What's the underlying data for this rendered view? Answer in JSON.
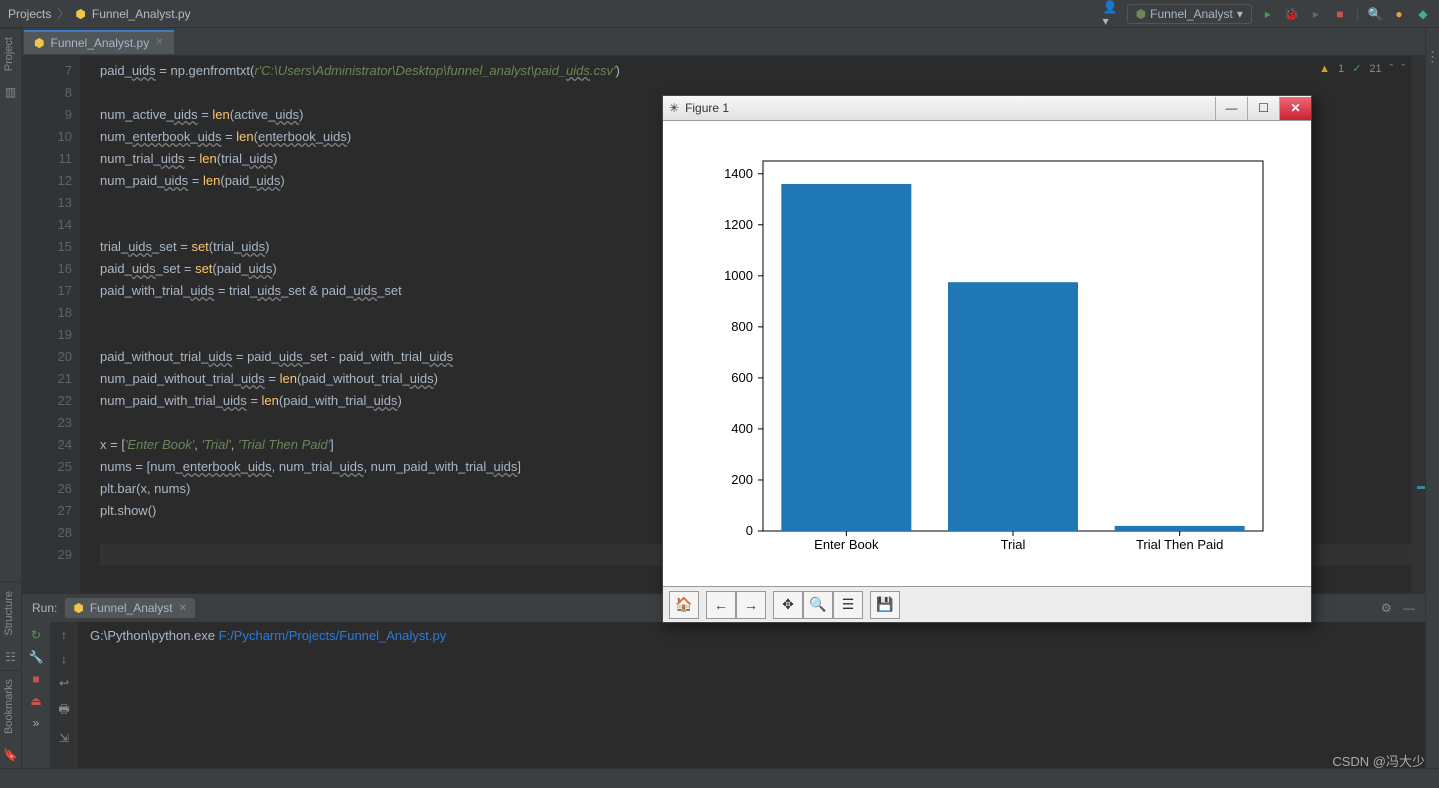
{
  "breadcrumb": {
    "root": "Projects",
    "file": "Funnel_Analyst.py"
  },
  "run_config": {
    "label": "Funnel_Analyst"
  },
  "editor_tab": {
    "label": "Funnel_Analyst.py"
  },
  "editor_status": {
    "warnings": "1",
    "weak_warnings": "21"
  },
  "gutter_lines": [
    "7",
    "8",
    "9",
    "10",
    "11",
    "12",
    "13",
    "14",
    "15",
    "16",
    "17",
    "18",
    "19",
    "20",
    "21",
    "22",
    "23",
    "24",
    "25",
    "26",
    "27",
    "28",
    "29"
  ],
  "code_tokens": [
    [
      {
        "t": "paid_",
        "c": "var"
      },
      {
        "t": "uids",
        "c": "wavy"
      },
      {
        "t": " = np.genfromtxt(",
        "c": "var"
      },
      {
        "t": "r'C:\\Users\\Administrator\\Desktop\\funnel_analyst\\paid_",
        "c": "str"
      },
      {
        "t": "uids",
        "c": "str wavy"
      },
      {
        "t": ".csv'",
        "c": "str"
      },
      {
        "t": ")",
        "c": "var"
      }
    ],
    [],
    [
      {
        "t": "num_active_",
        "c": "var"
      },
      {
        "t": "uids",
        "c": "wavy"
      },
      {
        "t": " = ",
        "c": "var"
      },
      {
        "t": "len",
        "c": "fn"
      },
      {
        "t": "(active_",
        "c": "var"
      },
      {
        "t": "uids",
        "c": "wavy"
      },
      {
        "t": ")",
        "c": "var"
      }
    ],
    [
      {
        "t": "num_",
        "c": "var"
      },
      {
        "t": "enterbook",
        "c": "wavy"
      },
      {
        "t": "_",
        "c": "var"
      },
      {
        "t": "uids",
        "c": "wavy"
      },
      {
        "t": " = ",
        "c": "var"
      },
      {
        "t": "len",
        "c": "fn"
      },
      {
        "t": "(",
        "c": "var"
      },
      {
        "t": "enterbook",
        "c": "wavy"
      },
      {
        "t": "_",
        "c": "var"
      },
      {
        "t": "uids",
        "c": "wavy"
      },
      {
        "t": ")",
        "c": "var"
      }
    ],
    [
      {
        "t": "num_trial_",
        "c": "var"
      },
      {
        "t": "uids",
        "c": "wavy"
      },
      {
        "t": " = ",
        "c": "var"
      },
      {
        "t": "len",
        "c": "fn"
      },
      {
        "t": "(trial_",
        "c": "var"
      },
      {
        "t": "uids",
        "c": "wavy"
      },
      {
        "t": ")",
        "c": "var"
      }
    ],
    [
      {
        "t": "num_paid_",
        "c": "var"
      },
      {
        "t": "uids",
        "c": "wavy"
      },
      {
        "t": " = ",
        "c": "var"
      },
      {
        "t": "len",
        "c": "fn"
      },
      {
        "t": "(paid_",
        "c": "var"
      },
      {
        "t": "uids",
        "c": "wavy"
      },
      {
        "t": ")",
        "c": "var"
      }
    ],
    [],
    [],
    [
      {
        "t": "trial_",
        "c": "var"
      },
      {
        "t": "uids",
        "c": "wavy"
      },
      {
        "t": "_set = ",
        "c": "var"
      },
      {
        "t": "set",
        "c": "fn"
      },
      {
        "t": "(trial_",
        "c": "var"
      },
      {
        "t": "uids",
        "c": "wavy"
      },
      {
        "t": ")",
        "c": "var"
      }
    ],
    [
      {
        "t": "paid_",
        "c": "var"
      },
      {
        "t": "uids",
        "c": "wavy"
      },
      {
        "t": "_set = ",
        "c": "var"
      },
      {
        "t": "set",
        "c": "fn"
      },
      {
        "t": "(paid_",
        "c": "var"
      },
      {
        "t": "uids",
        "c": "wavy"
      },
      {
        "t": ")",
        "c": "var"
      }
    ],
    [
      {
        "t": "paid_with_trial_",
        "c": "var"
      },
      {
        "t": "uids",
        "c": "wavy"
      },
      {
        "t": " = trial_",
        "c": "var"
      },
      {
        "t": "uids",
        "c": "wavy"
      },
      {
        "t": "_set & paid_",
        "c": "var"
      },
      {
        "t": "uids",
        "c": "wavy"
      },
      {
        "t": "_set",
        "c": "var"
      }
    ],
    [],
    [],
    [
      {
        "t": "paid_without_trial_",
        "c": "var"
      },
      {
        "t": "uids",
        "c": "wavy"
      },
      {
        "t": " = paid_",
        "c": "var"
      },
      {
        "t": "uids",
        "c": "wavy"
      },
      {
        "t": "_set - paid_with_trial_",
        "c": "var"
      },
      {
        "t": "uids",
        "c": "wavy"
      }
    ],
    [
      {
        "t": "num_paid_without_trial_",
        "c": "var"
      },
      {
        "t": "uids",
        "c": "wavy"
      },
      {
        "t": " = ",
        "c": "var"
      },
      {
        "t": "len",
        "c": "fn"
      },
      {
        "t": "(paid_without_trial_",
        "c": "var"
      },
      {
        "t": "uids",
        "c": "wavy"
      },
      {
        "t": ")",
        "c": "var"
      }
    ],
    [
      {
        "t": "num_paid_with_trial_",
        "c": "var"
      },
      {
        "t": "uids",
        "c": "wavy"
      },
      {
        "t": " = ",
        "c": "var"
      },
      {
        "t": "len",
        "c": "fn"
      },
      {
        "t": "(paid_with_trial_",
        "c": "var"
      },
      {
        "t": "uids",
        "c": "wavy"
      },
      {
        "t": ")",
        "c": "var"
      }
    ],
    [],
    [
      {
        "t": "x = [",
        "c": "var"
      },
      {
        "t": "'Enter Book'",
        "c": "str"
      },
      {
        "t": ", ",
        "c": "var"
      },
      {
        "t": "'Trial'",
        "c": "str"
      },
      {
        "t": ", ",
        "c": "var"
      },
      {
        "t": "'Trial Then Paid'",
        "c": "str"
      },
      {
        "t": "]",
        "c": "var"
      }
    ],
    [
      {
        "t": "nums = [num_",
        "c": "var"
      },
      {
        "t": "enterbook",
        "c": "wavy"
      },
      {
        "t": "_",
        "c": "var"
      },
      {
        "t": "uids",
        "c": "wavy"
      },
      {
        "t": ", num_trial_",
        "c": "var"
      },
      {
        "t": "uids",
        "c": "wavy"
      },
      {
        "t": ", num_paid_with_trial_",
        "c": "var"
      },
      {
        "t": "uids",
        "c": "wavy"
      },
      {
        "t": "]",
        "c": "var"
      }
    ],
    [
      {
        "t": "plt.bar(x, nums)",
        "c": "var"
      }
    ],
    [
      {
        "t": "plt.show()",
        "c": "var"
      }
    ],
    [],
    []
  ],
  "side_tabs": {
    "project": "Project",
    "structure": "Structure",
    "bookmarks": "Bookmarks"
  },
  "run_panel": {
    "label": "Run:",
    "tab": "Funnel_Analyst"
  },
  "console": {
    "exe_prefix": "G:\\Python\\python.exe ",
    "script": "F:/Pycharm/Projects/Funnel_Analyst.py"
  },
  "figure": {
    "title": "Figure 1"
  },
  "chart_data": {
    "type": "bar",
    "categories": [
      "Enter Book",
      "Trial",
      "Trial Then Paid"
    ],
    "values": [
      1360,
      975,
      20
    ],
    "yticks": [
      0,
      200,
      400,
      600,
      800,
      1000,
      1200,
      1400
    ],
    "ylim": [
      0,
      1450
    ]
  },
  "watermark": "CSDN @冯大少"
}
